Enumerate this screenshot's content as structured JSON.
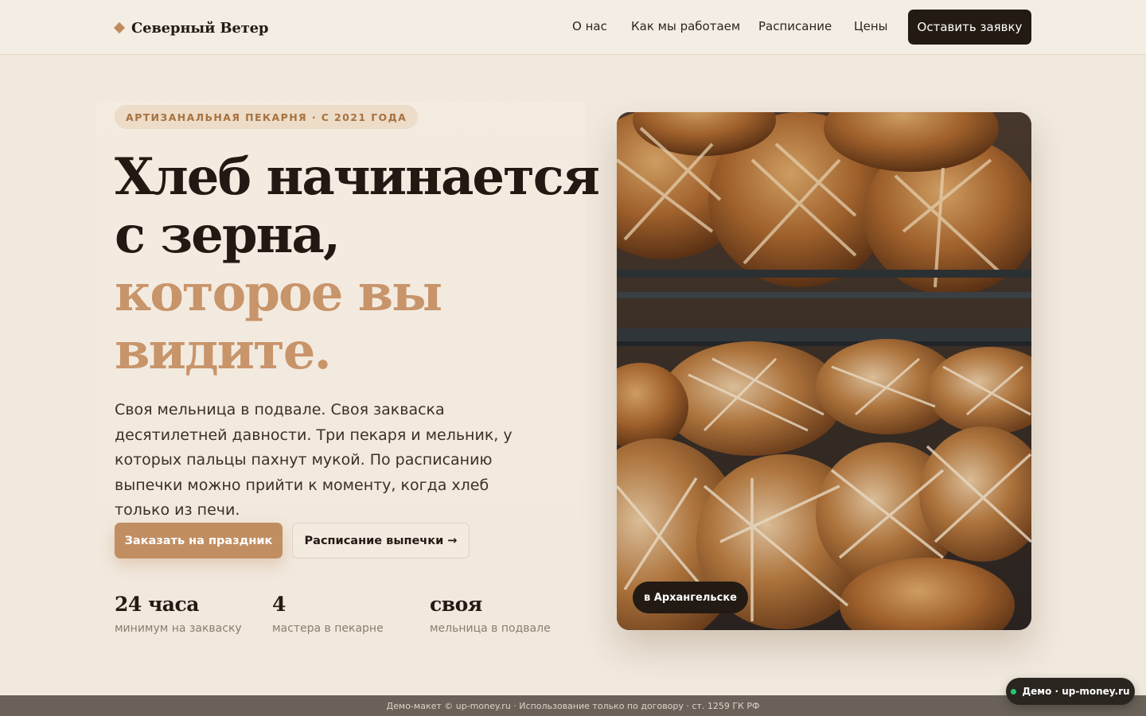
{
  "header": {
    "logo": "Северный Ветер",
    "nav": [
      "О нас",
      "Как мы работаем",
      "Расписание",
      "Цены"
    ],
    "cta": "Оставить заявку"
  },
  "hero": {
    "badge": "АРТИЗАНАЛЬНАЯ ПЕКАРНЯ · С 2021 ГОДА",
    "title_dark": [
      "Хлеб начинается",
      "с зерна,"
    ],
    "title_accent": [
      "которое вы",
      "видите."
    ],
    "lead": "Своя мельница в подвале. Своя закваска десятилетней давности. Три пекаря и мельник, у которых пальцы пахнут мукой. По расписанию выпечки можно прийти к моменту, когда хлеб только из печи.",
    "primary_button": "Заказать на праздник",
    "secondary_button": "Расписание выпечки →",
    "stats": [
      {
        "value": "24 часа",
        "label": "минимум на закваску"
      },
      {
        "value": "4",
        "label": "мастера в пекарне"
      },
      {
        "value": "своя",
        "label": "мельница в подвале"
      }
    ],
    "photo_tag": "в Архангельске"
  },
  "footer": {
    "text": "Демо-макет © up-money.ru · Использование только по договору · ст. 1259 ГК РФ",
    "demo_badge": "Демо · up-money.ru"
  },
  "colors": {
    "background": "#f1e9de",
    "accent": "#c18e62",
    "dark": "#231a12"
  }
}
